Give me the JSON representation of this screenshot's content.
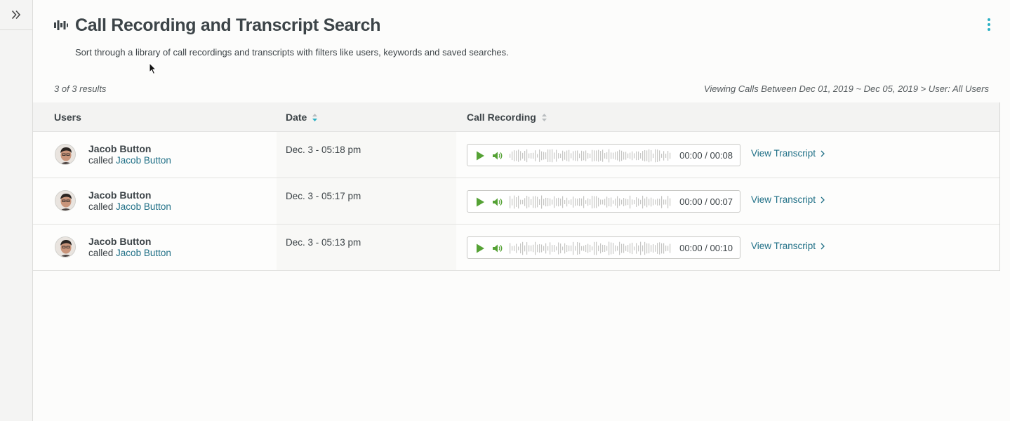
{
  "header": {
    "title": "Call Recording and Transcript Search",
    "subtitle": "Sort through a library of call recordings and transcripts with filters like users, keywords and saved searches.",
    "icons": {
      "title": "audio-bars-icon",
      "menu": "kebab-menu-icon",
      "sidebar_toggle": "double-chevron-right-icon"
    }
  },
  "results": {
    "count_text": "3 of 3 results",
    "viewing_text": "Viewing Calls Between Dec 01, 2019 ~ Dec 05, 2019 > User: All Users"
  },
  "table": {
    "columns": {
      "users": "Users",
      "date": "Date",
      "recording": "Call Recording"
    },
    "sort": {
      "date": "descending",
      "recording": "none"
    },
    "rows": [
      {
        "user": "Jacob Button",
        "called_prefix": "called",
        "called_user": "Jacob Button",
        "date": "Dec. 3 - 05:18 pm",
        "time": "00:00 / 00:08",
        "link": "View Transcript"
      },
      {
        "user": "Jacob Button",
        "called_prefix": "called",
        "called_user": "Jacob Button",
        "date": "Dec. 3 - 05:17 pm",
        "time": "00:00 / 00:07",
        "link": "View Transcript"
      },
      {
        "user": "Jacob Button",
        "called_prefix": "called",
        "called_user": "Jacob Button",
        "date": "Dec. 3 - 05:13 pm",
        "time": "00:00 / 00:10",
        "link": "View Transcript"
      }
    ]
  },
  "colors": {
    "accent": "#1f6f86",
    "play": "#55a235",
    "sort_active": "#2bb0c4",
    "text": "#3d4448"
  }
}
